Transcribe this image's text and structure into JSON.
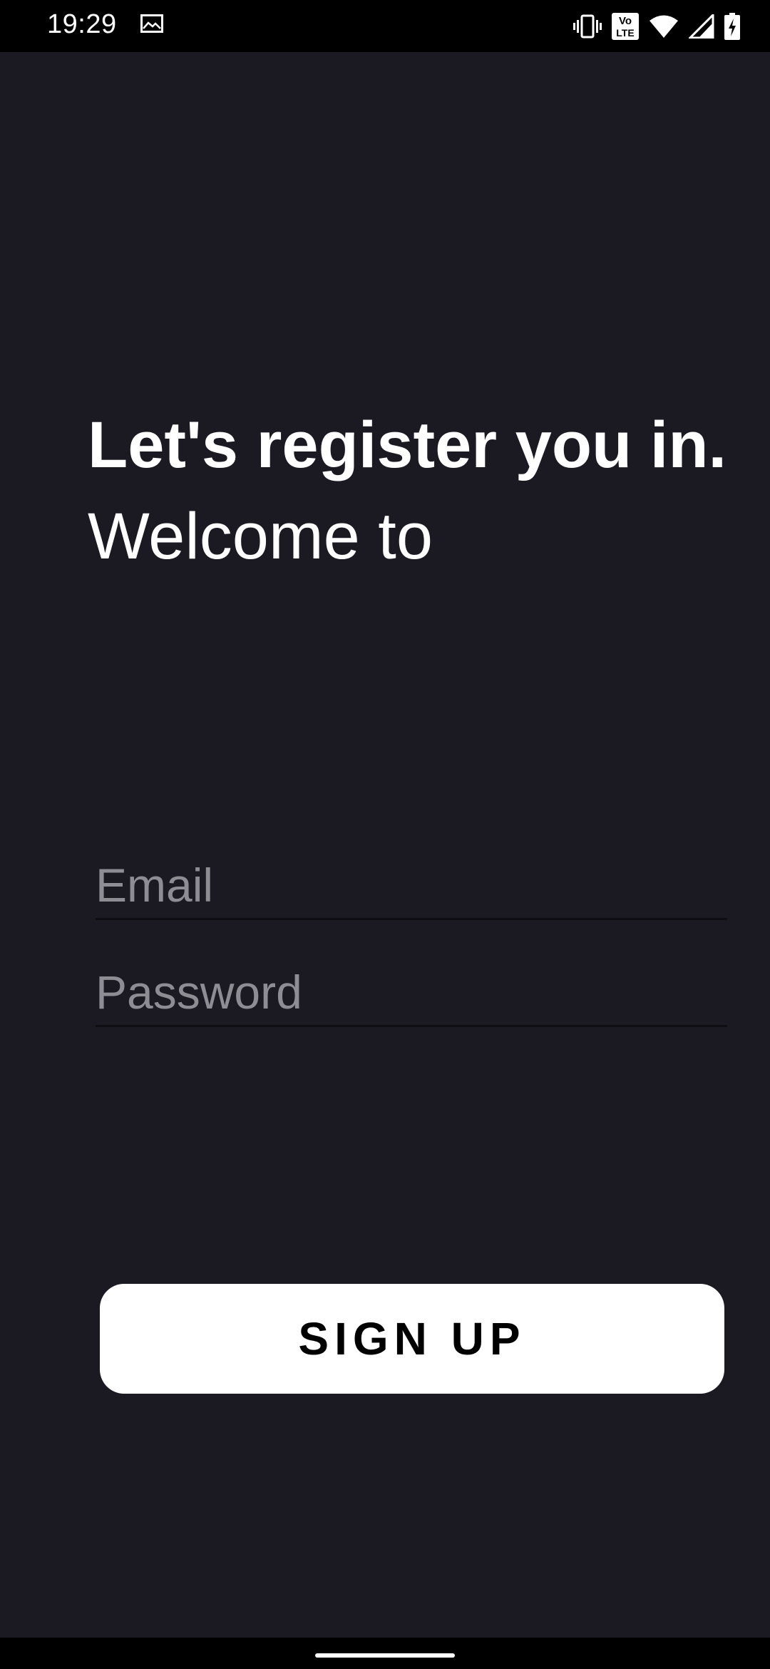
{
  "status_bar": {
    "time": "19:29",
    "icons": [
      "gallery-icon",
      "vibrate-icon",
      "volte-icon",
      "wifi-icon",
      "cell-signal-icon",
      "battery-charging-icon"
    ],
    "volte_top": "Vo",
    "volte_bottom": "LTE"
  },
  "main": {
    "title": "Let's register you in.",
    "subtitle": "Welcome to"
  },
  "form": {
    "email_placeholder": "Email",
    "email_value": "",
    "password_placeholder": "Password",
    "password_value": ""
  },
  "actions": {
    "signup_label": "SIGN UP"
  },
  "colors": {
    "background": "#1b1a23",
    "status_bar": "#000000",
    "text": "#ffffff",
    "placeholder": "#8e8d94",
    "button_bg": "#ffffff",
    "button_text": "#000000"
  }
}
